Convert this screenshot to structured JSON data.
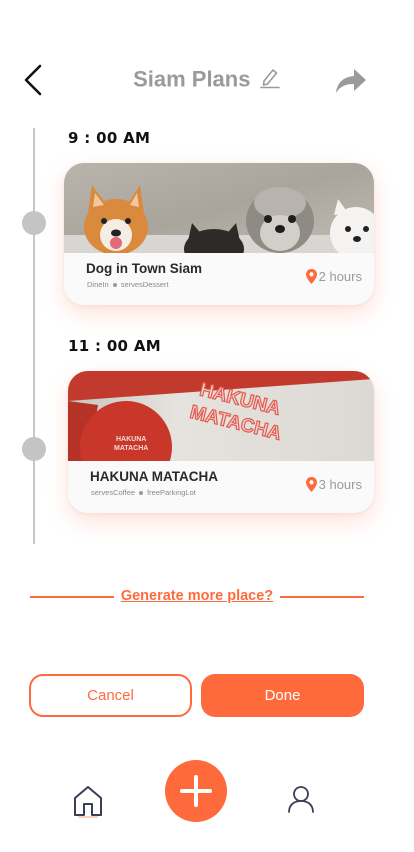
{
  "header": {
    "title": "Siam Plans",
    "icons": {
      "back": "back-arrow-icon",
      "edit": "pencil-icon",
      "share": "share-arrow-icon"
    }
  },
  "timeline": [
    {
      "time": "9 : 00 AM",
      "place": {
        "name": "Dog in Town Siam",
        "tags": [
          "DineIn",
          "servesDessert"
        ],
        "duration": "2 hours",
        "image": "dogs-photo"
      }
    },
    {
      "time": "11 : 00 AM",
      "place": {
        "name": "HAKUNA MATACHA",
        "tags": [
          "servesCoffee",
          "freeParkingLot"
        ],
        "duration": "3 hours",
        "image": "cafe-interior-photo",
        "sign_lines": [
          "HAKUNA",
          "MATACHA"
        ]
      }
    }
  ],
  "generate_more": "Generate more place?",
  "actions": {
    "cancel": "Cancel",
    "done": "Done"
  },
  "bottom_nav": {
    "icons": [
      "home-icon",
      "add-icon",
      "profile-icon"
    ]
  },
  "colors": {
    "accent": "#ff6a3d",
    "muted": "#9a9a9a",
    "timeline": "#c8c8c8"
  }
}
